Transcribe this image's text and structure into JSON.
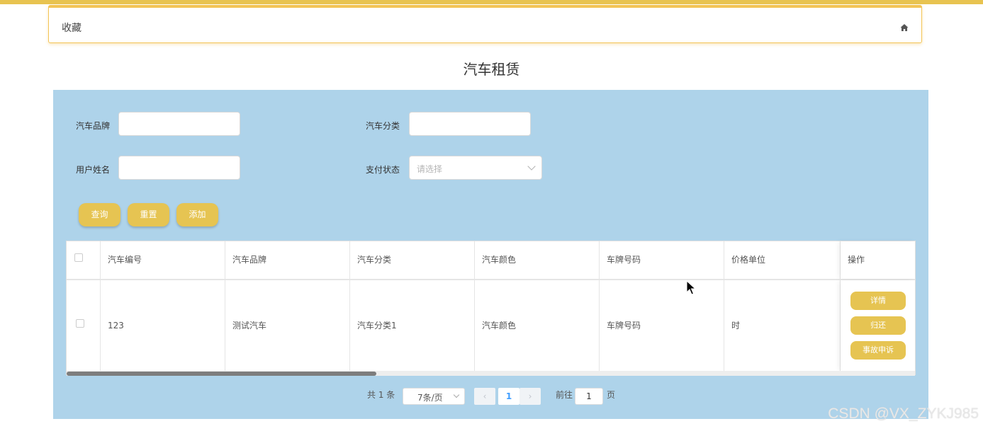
{
  "breadcrumb": {
    "label": "收藏"
  },
  "page": {
    "title": "汽车租赁"
  },
  "search": {
    "brand_label": "汽车品牌",
    "brand_value": "",
    "category_label": "汽车分类",
    "category_value": "",
    "username_label": "用户姓名",
    "username_value": "",
    "pay_status_label": "支付状态",
    "pay_status_placeholder": "请选择"
  },
  "buttons": {
    "query": "查询",
    "reset": "重置",
    "add": "添加"
  },
  "table": {
    "headers": [
      "汽车编号",
      "汽车品牌",
      "汽车分类",
      "汽车颜色",
      "车牌号码",
      "价格单位",
      "操作"
    ],
    "rows": [
      {
        "cells": [
          "123",
          "测试汽车",
          "汽车分类1",
          "汽车颜色",
          "车牌号码",
          "时"
        ]
      }
    ],
    "actions": [
      "详情",
      "归还",
      "事故申诉"
    ],
    "scroll_fraction": 0.36
  },
  "pagination": {
    "total": "共 1 条",
    "page_size": "7条/页",
    "prev": "‹",
    "current": "1",
    "next": "›",
    "goto_label": "前往",
    "goto_value": "1",
    "page_suffix": "页"
  },
  "watermark": "CSDN @VX_ZYKJ985",
  "colors": {
    "accent": "#e6c452",
    "panel": "#aed3ea",
    "topbar": "#e8c350"
  }
}
